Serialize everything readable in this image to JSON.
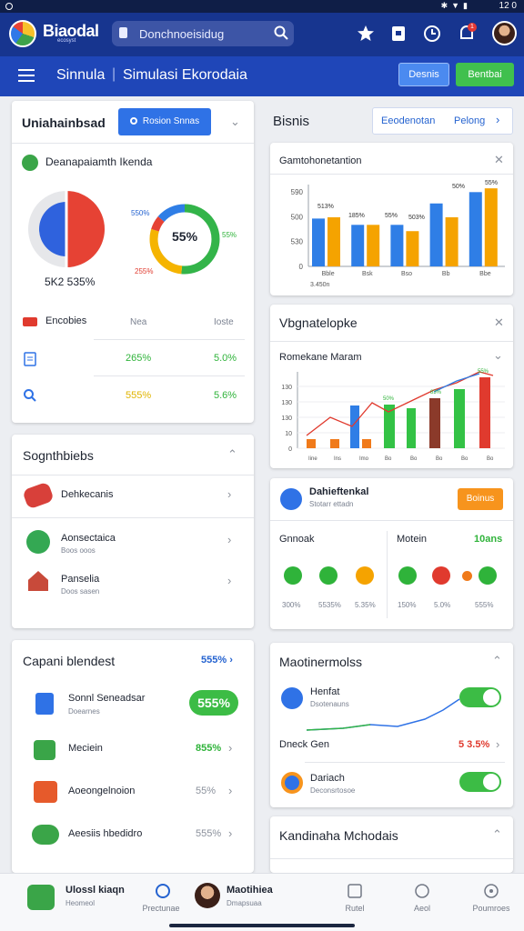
{
  "status": {
    "time": "12 0"
  },
  "topbar": {
    "brand": "Biaodal",
    "brand_sub": "ecosyst",
    "search_text": "Donchnoeisidug",
    "notif_count": "1"
  },
  "subbar": {
    "crumb1": "Sinnula",
    "crumb2": "Simulasi Ekorodaia",
    "btn_blue": "Desnis",
    "btn_green": "Bentbai"
  },
  "left_top": {
    "title": "Uniahainbsad",
    "button": "Rosion Snnas",
    "subtitle": "Deanapaiamth Ikenda",
    "pie_label": "5K2 535%",
    "donut_center": "55%",
    "donut_l1": "550%",
    "donut_r": "55%",
    "donut_l2": "255%",
    "rows_header": [
      "Encobies",
      "Nea",
      "Ioste"
    ],
    "rows": [
      {
        "v1": "265%",
        "v2": "5.0%"
      },
      {
        "v1": "555%",
        "v2": "5.6%"
      }
    ]
  },
  "right_top": {
    "title": "Bisnis",
    "tab1": "Eeodenotan",
    "tab2": "Pelong"
  },
  "bar_card": {
    "title": "Gamtohonetantion",
    "yticks": [
      "590",
      "500",
      "530",
      "0"
    ],
    "xticks": [
      "Bble",
      "Bsk",
      "Bso",
      "Bb",
      "Bbe"
    ],
    "footer": "3.450n",
    "labels": [
      "513%",
      "185%",
      "55%",
      "503%",
      "50%",
      "55%"
    ]
  },
  "chart_data": {
    "type": "bar",
    "categories": [
      "Bble",
      "Bsk",
      "Bso",
      "Bb",
      "Bbe"
    ],
    "series": [
      {
        "name": "",
        "values": [
          380,
          330,
          330,
          500,
          590
        ],
        "color": "#2f7ee6"
      },
      {
        "name": "",
        "values": [
          390,
          330,
          280,
          390,
          620
        ],
        "color": "#f5a300"
      },
      {
        "name": "",
        "values": [
          0,
          0,
          0,
          0,
          0
        ],
        "color": "#33c245"
      }
    ],
    "ylim": [
      0,
      650
    ]
  },
  "viz_card": {
    "title": "Vbgnatelopke",
    "subtitle": "Romekane Maram",
    "yticks": [
      "130",
      "130",
      "130",
      "10",
      "0"
    ],
    "xticks": [
      "Iine",
      "Ins",
      "Imo",
      "Bo",
      "Bo",
      "Bo",
      "Bo",
      "Bo"
    ],
    "labels": [
      "50%",
      "83%",
      "55%"
    ]
  },
  "seg_card": {
    "title": "Sognthbiebs",
    "items": [
      {
        "title": "Dehkecanis",
        "sub": ""
      },
      {
        "title": "Aonsectaica",
        "sub": "Boos ooos"
      },
      {
        "title": "Panselia",
        "sub": "Doos sasen"
      }
    ]
  },
  "stat_card": {
    "title": "Dahieftenkal",
    "sub": "Stotarr ettadn",
    "button": "Boinus",
    "col1_title": "Gnnoak",
    "col2_title": "Motein",
    "col2_value": "10ans",
    "col1_vals": [
      "300%",
      "5535%",
      "5.35%"
    ],
    "col2_vals": [
      "150%",
      "5.0%",
      "555%"
    ]
  },
  "capital_card": {
    "title": "Capani blendest",
    "link": "555%",
    "items": [
      {
        "title": "Sonnl Seneadsar",
        "sub": "Doearnes",
        "value": "555%"
      },
      {
        "title": "Meciein",
        "sub": "",
        "value": "855%"
      },
      {
        "title": "Aoeongelnoion",
        "sub": "",
        "value": "55%"
      },
      {
        "title": "Aeesiis hbedidro",
        "sub": "",
        "value": "555%"
      }
    ]
  },
  "monitor_card": {
    "title": "Maotinermolss",
    "item1_title": "Henfat",
    "item1_sub": "Dsotenauns",
    "item2_title": "Dneck Gen",
    "item2_value": "5 3.5%",
    "item3_title": "Dariach",
    "item3_sub": "Deconsrtosoe"
  },
  "last_card": {
    "title": "Kandinaha Mchodais"
  },
  "bottom_nav": {
    "profile1_title": "Ulossl kiaqn",
    "profile1_sub": "Heomeol",
    "tab_active": "Prectunae",
    "profile2_title": "Maotihiea",
    "profile2_sub": "Dmapsuaa",
    "tab3": "Rutel",
    "tab4": "Aeol",
    "tab5": "Poumroes"
  }
}
